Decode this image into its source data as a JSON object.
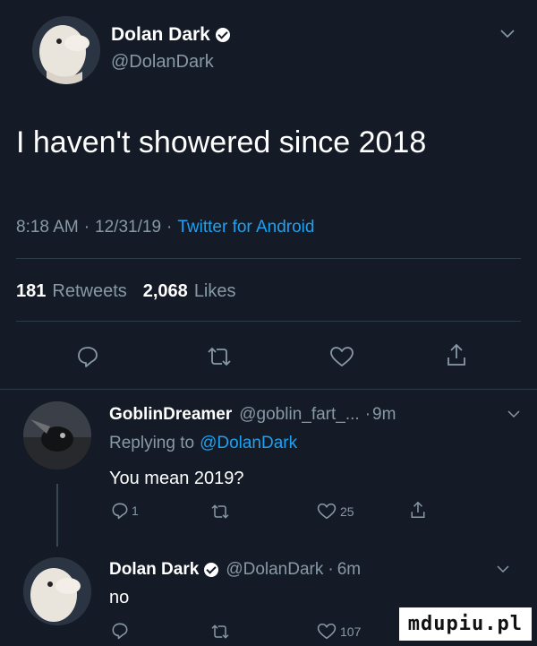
{
  "tweet": {
    "author_name": "Dolan Dark",
    "author_handle": "@DolanDark",
    "text": "I haven't showered since 2018",
    "time": "8:18 AM",
    "date": "12/31/19",
    "client": "Twitter for Android",
    "retweets_count": "181",
    "retweets_label": "Retweets",
    "likes_count": "2,068",
    "likes_label": "Likes",
    "sep": "·"
  },
  "reply1": {
    "author_name": "GoblinDreamer",
    "author_handle": "@goblin_fart_...",
    "time": "9m",
    "replying_prefix": "Replying to",
    "replying_handle": "@DolanDark",
    "text": "You mean 2019?",
    "reply_count": "1",
    "like_count": "25"
  },
  "reply2": {
    "author_name": "Dolan Dark",
    "author_handle": "@DolanDark",
    "time": "6m",
    "text": "no",
    "like_count": "107"
  },
  "watermark": "mdupiu.pl",
  "colors": {
    "background": "#141b26",
    "accent": "#1da1f2",
    "muted": "#8899a6"
  },
  "icons": [
    "chevron-down-icon",
    "reply-icon",
    "retweet-icon",
    "like-icon",
    "share-icon",
    "verified-icon"
  ]
}
